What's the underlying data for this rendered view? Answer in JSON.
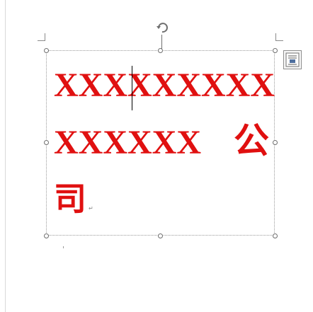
{
  "textbox": {
    "line1": "XXXXXXXXX",
    "line2": "XXXXXX",
    "line2_cjk": "公",
    "line3_cjk": "司",
    "paragraph_mark": "↵"
  },
  "colors": {
    "text": "#e01010",
    "handle_border": "#6f6f6f",
    "selection_border": "#9a9a9a"
  },
  "icons": {
    "rotate": "rotate-handle-icon",
    "layout_options": "layout-options-icon"
  }
}
